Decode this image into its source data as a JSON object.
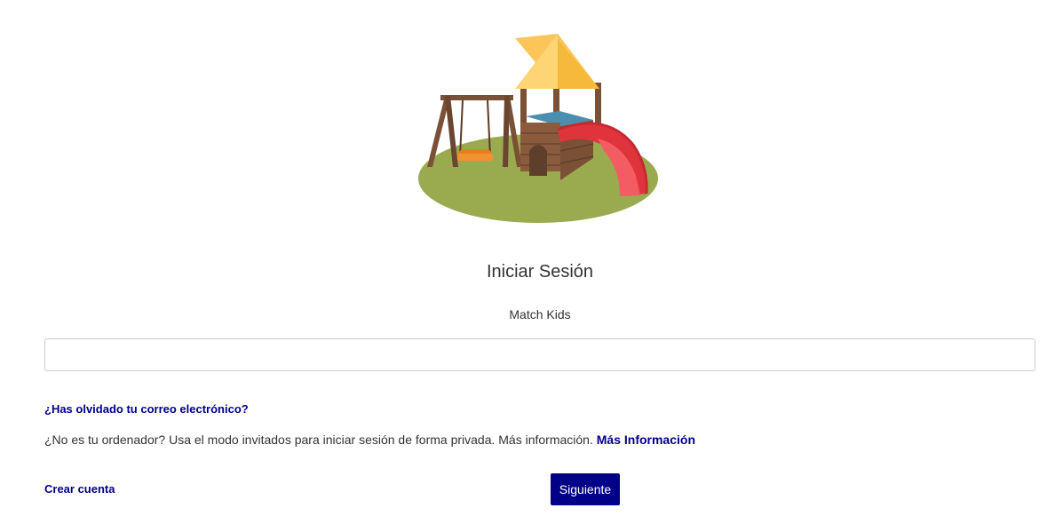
{
  "login": {
    "title": "Iniciar Sesión",
    "app_name": "Match Kids",
    "email_value": "",
    "forgot_email": "¿Has olvidado tu correo electrónico?",
    "guest_text": "¿No es tu ordenador? Usa el modo invitados para iniciar sesión de forma privada. Más información.",
    "more_info": "Más Información",
    "create_account": "Crear cuenta",
    "next": "Siguiente"
  },
  "illustration": {
    "icon": "playground-illustration",
    "colors": {
      "grass": "#9aab4f",
      "roof": "#fcc55a",
      "wood": "#7b5136",
      "slide": "#e0343d",
      "floor": "#4b8fb0",
      "seat": "#f0922f"
    }
  },
  "theme": {
    "link_color": "#00008b",
    "button_color": "#000088"
  }
}
